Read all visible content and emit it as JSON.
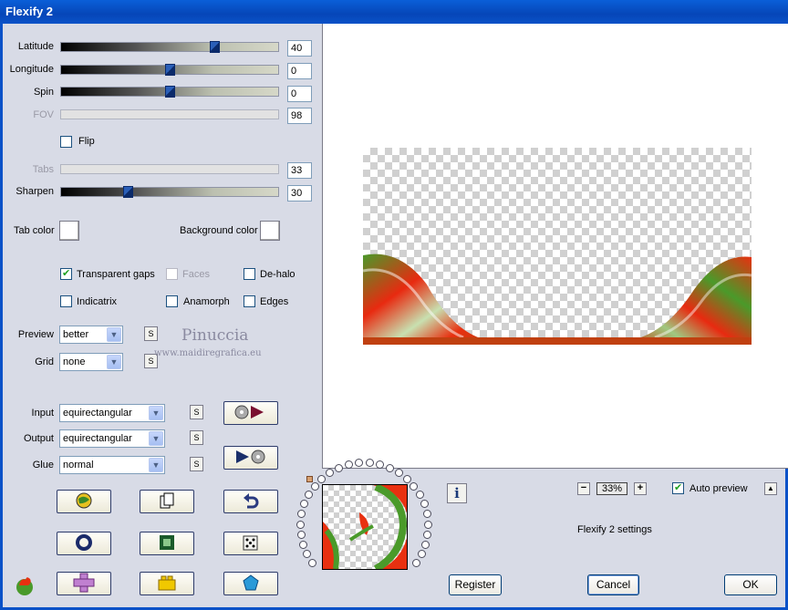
{
  "window": {
    "title": "Flexify 2"
  },
  "sliders": [
    {
      "label": "Latitude",
      "value": "40",
      "level": 0.72,
      "enabled": true
    },
    {
      "label": "Longitude",
      "value": "0",
      "level": 0.5,
      "enabled": true
    },
    {
      "label": "Spin",
      "value": "0",
      "level": 0.5,
      "enabled": true
    },
    {
      "label": "FOV",
      "value": "98",
      "level": null,
      "enabled": false
    },
    {
      "label": "Tabs",
      "value": "33",
      "level": null,
      "enabled": false
    },
    {
      "label": "Sharpen",
      "value": "30",
      "level": 0.3,
      "enabled": true
    }
  ],
  "flip": {
    "label": "Flip",
    "checked": false
  },
  "colors": {
    "tab_color_label": "Tab color",
    "background_color_label": "Background color",
    "tab_color": "#ffffff",
    "background_color": "#ffffff"
  },
  "options": {
    "transparent_gaps": {
      "label": "Transparent gaps",
      "checked": true
    },
    "faces": {
      "label": "Faces",
      "checked": false,
      "enabled": false
    },
    "de_halo": {
      "label": "De-halo",
      "checked": false
    },
    "indicatrix": {
      "label": "Indicatrix",
      "checked": false
    },
    "anamorph": {
      "label": "Anamorph",
      "checked": false
    },
    "edges": {
      "label": "Edges",
      "checked": false
    }
  },
  "preview_quality": {
    "label": "Preview",
    "value": "better"
  },
  "grid": {
    "label": "Grid",
    "value": "none"
  },
  "projection": {
    "input": {
      "label": "Input",
      "value": "equirectangular"
    },
    "output": {
      "label": "Output",
      "value": "equirectangular"
    },
    "glue": {
      "label": "Glue",
      "value": "normal"
    }
  },
  "s_button_label": "S",
  "watermark": {
    "name": "Pinuccia",
    "url": "www.maidiregrafica.eu"
  },
  "zoom": {
    "minus": "−",
    "value": "33%",
    "plus": "+"
  },
  "auto_preview": {
    "label": "Auto preview",
    "checked": true,
    "arrow": "▲"
  },
  "settings_caption": "Flexify 2 settings",
  "info_icon": "i",
  "buttons": {
    "register": "Register",
    "cancel": "Cancel",
    "ok": "OK"
  },
  "icons": [
    "record-play-icon",
    "play-record-icon",
    "globe-icon",
    "copy-icon",
    "undo-icon",
    "ring-icon",
    "square-icon",
    "dice-icon",
    "plus-shape-icon",
    "lego-brick-icon",
    "pentagon-icon",
    "fire-globe-icon"
  ]
}
